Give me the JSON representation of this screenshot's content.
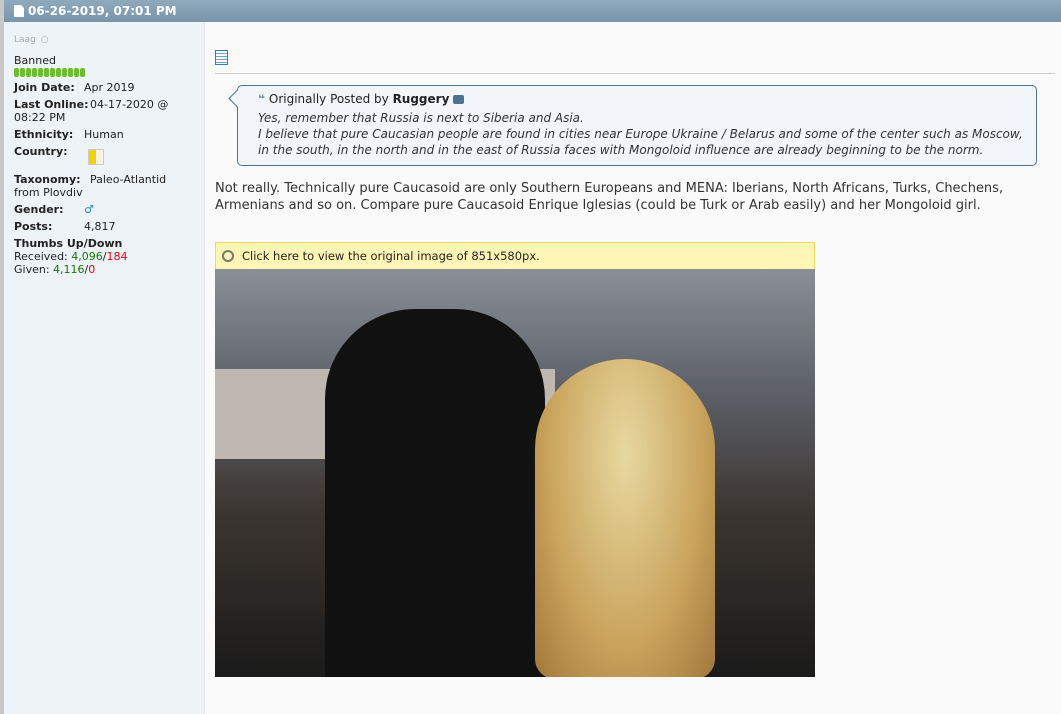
{
  "header": {
    "date": "06-26-2019, 07:01 PM"
  },
  "user": {
    "name": "Laag",
    "title": "Banned",
    "reputation_bars": 12,
    "fields": [
      {
        "label": "Join Date:",
        "value": "Apr 2019"
      },
      {
        "label": "Last Online:",
        "value": "04-17-2020 @ 08:22 PM"
      },
      {
        "label": "Ethnicity:",
        "value": "Human"
      },
      {
        "label": "Country:",
        "value": ""
      },
      {
        "label": "Taxonomy:",
        "value": "Paleo-Atlantid from Plovdiv"
      },
      {
        "label": "Gender:",
        "value": "♂"
      },
      {
        "label": "Posts:",
        "value": "4,817"
      }
    ],
    "thumbs": {
      "heading": "Thumbs Up/Down",
      "received_label": "Received:",
      "received_up": "4,096",
      "received_down": "184",
      "given_label": "Given:",
      "given_up": "4,116",
      "given_down": "0"
    }
  },
  "quote": {
    "prefix": "Originally Posted by",
    "author": "Ruggery",
    "line1": "Yes, remember that Russia is next to Siberia and Asia.",
    "line2": "I believe that pure Caucasian people are found in cities near Europe Ukraine / Belarus and some of the center such as Moscow, in the south, in the north and in the east of Russia faces with Mongoloid influence are already beginning to be the norm."
  },
  "post": {
    "text": "Not really. Technically pure Caucasoid are only Southern Europeans and MENA: Iberians, North Africans, Turks, Chechens, Armenians and so on. Compare pure Caucasoid Enrique Iglesias (could be Turk or Arab easily) and her Mongoloid girl.",
    "image_bar": "Click here to view the original image of 851x580px."
  },
  "colors": {
    "header": "#7f9bb0",
    "positive": "#117a00",
    "negative": "#e00000",
    "quote_border": "#4e7391"
  }
}
